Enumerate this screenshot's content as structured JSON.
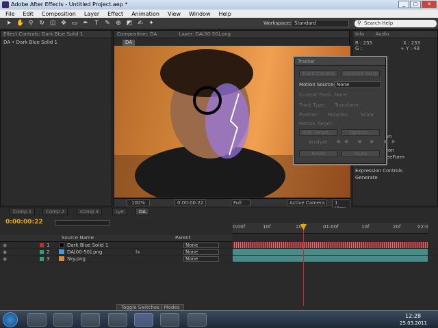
{
  "window": {
    "title": "Adobe After Effects - Untitled Project.aep *",
    "controls": [
      "_",
      "□",
      "✕"
    ]
  },
  "menu": [
    "File",
    "Edit",
    "Composition",
    "Layer",
    "Effect",
    "Animation",
    "View",
    "Window",
    "Help"
  ],
  "toolbar": {
    "workspace_label": "Workspace:",
    "workspace_value": "Standard",
    "search_value": "Search Help"
  },
  "effect_controls": {
    "tab": "Effect Controls: Dark Blue Solid 1",
    "breadcrumb": "DA • Dark Blue Solid 1"
  },
  "composition": {
    "tab": "Composition: DA",
    "layer_tab": "Layer: DA[00-50].png",
    "comp_button": "DA",
    "zoom": "100%",
    "time": "0:00:00:22",
    "resolution": "Full",
    "camera": "Active Camera",
    "view": "1 View"
  },
  "info": {
    "tab": "Info",
    "audio_tab": "Audio",
    "r": "R : 255",
    "g": "G :",
    "x": "X : 233",
    "y": "+ Y : 48"
  },
  "effects_list": [
    "Blur & Sharpen",
    "Channel",
    "Color Correction",
    "Digieffects FreeForm",
    "Distort",
    "Expression Controls",
    "Generate"
  ],
  "tracker": {
    "title": "Tracker",
    "track_camera": "Track Camera",
    "warp_stabilizer": "Stabilize Warp",
    "track_motion": "Track Motion",
    "stabilize_motion": "Stabilize Motion",
    "motion_source_label": "Motion Source:",
    "motion_source_value": "None",
    "current_track_label": "Current Track:",
    "current_track_value": "None",
    "track_type_label": "Track Type:",
    "track_type_value": "Transform",
    "position": "Position",
    "rotation": "Rotation",
    "scale": "Scale",
    "motion_target": "Motion Target:",
    "edit_target": "Edit Target...",
    "options": "Options...",
    "analyze": "Analyze:",
    "reset": "Reset",
    "apply": "Apply"
  },
  "timeline": {
    "tabs": [
      "Comp 1",
      "Comp 2",
      "Comp 3",
      "Lye",
      "DA"
    ],
    "time": "0:00:00:22",
    "col_source": "Source Name",
    "col_mode": "Parent",
    "ticks": [
      "0:00f",
      "10f",
      "20f",
      "01:00f",
      "10f",
      "20f",
      "02:0"
    ],
    "toggle": "Toggle Switches / Modes",
    "layers": [
      {
        "num": "1",
        "name": "Dark Blue Solid 1",
        "parent": "None",
        "color": "#c03030"
      },
      {
        "num": "2",
        "name": "DA[00-50].png",
        "parent": "None",
        "color": "#3a9a7a"
      },
      {
        "num": "3",
        "name": "Sky.png",
        "parent": "None",
        "color": "#3a9a7a"
      }
    ]
  },
  "taskbar": {
    "time": "12:28",
    "date": "25.03.2011"
  },
  "colors": {
    "accent": "#e8a800",
    "solid_track": "#8a2a2a",
    "png_track": "#4a8a8a"
  }
}
